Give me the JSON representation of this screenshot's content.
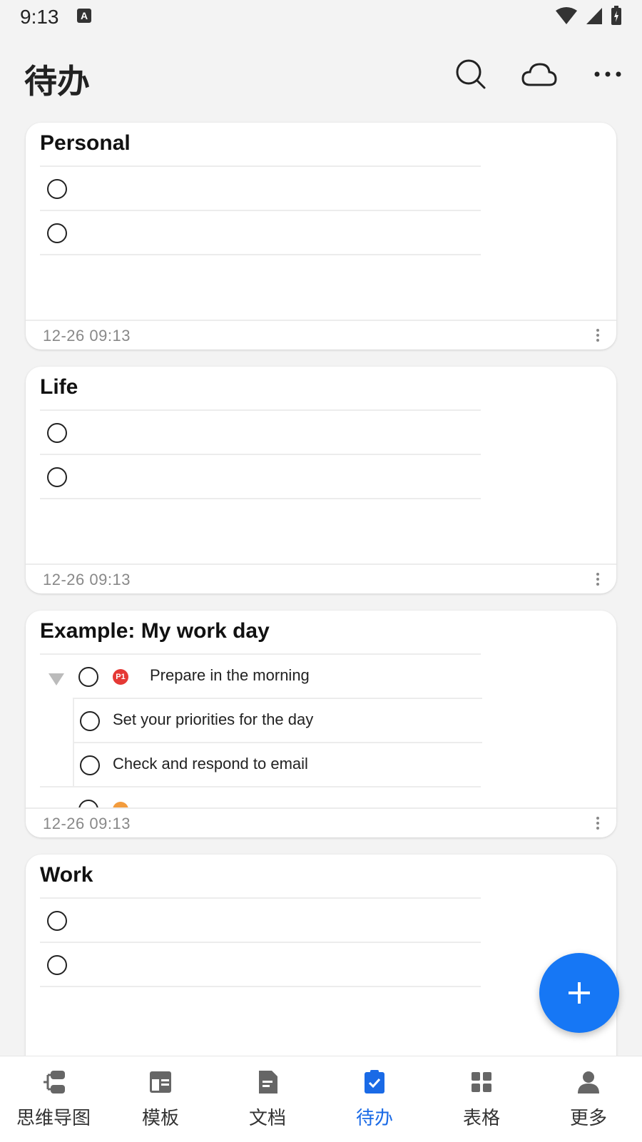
{
  "status": {
    "time": "9:13",
    "app_badge": "A"
  },
  "header": {
    "title": "待办"
  },
  "cards": [
    {
      "title": "Personal",
      "date": "12-26 09:13"
    },
    {
      "title": "Life",
      "date": "12-26 09:13"
    },
    {
      "title": "Example: My work day",
      "date": "12-26 09:13",
      "tasks": [
        {
          "text": "Prepare in the morning",
          "priority": "P1"
        },
        {
          "text": "Set your priorities for the day"
        },
        {
          "text": "Check and respond to email"
        }
      ]
    },
    {
      "title": "Work"
    }
  ],
  "nav": [
    {
      "label": "思维导图",
      "icon": "mindmap-icon"
    },
    {
      "label": "模板",
      "icon": "template-icon"
    },
    {
      "label": "文档",
      "icon": "document-icon"
    },
    {
      "label": "待办",
      "icon": "todo-icon"
    },
    {
      "label": "表格",
      "icon": "table-icon"
    },
    {
      "label": "更多",
      "icon": "profile-icon"
    }
  ],
  "colors": {
    "accent": "#1677f5",
    "priority_p1": "#e53935"
  }
}
